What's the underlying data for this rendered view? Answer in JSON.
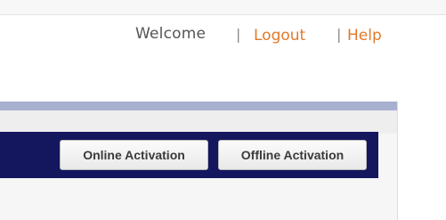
{
  "header": {
    "welcome_text": "Welcome",
    "separator": "|",
    "logout_label": "Logout",
    "help_label": "Help"
  },
  "toolbar": {
    "online_activation_label": "Online Activation",
    "offline_activation_label": "Offline Activation"
  },
  "colors": {
    "nav_bar": "#14165e",
    "link": "#e07a2a",
    "panel_strip": "#a8b0cf"
  }
}
